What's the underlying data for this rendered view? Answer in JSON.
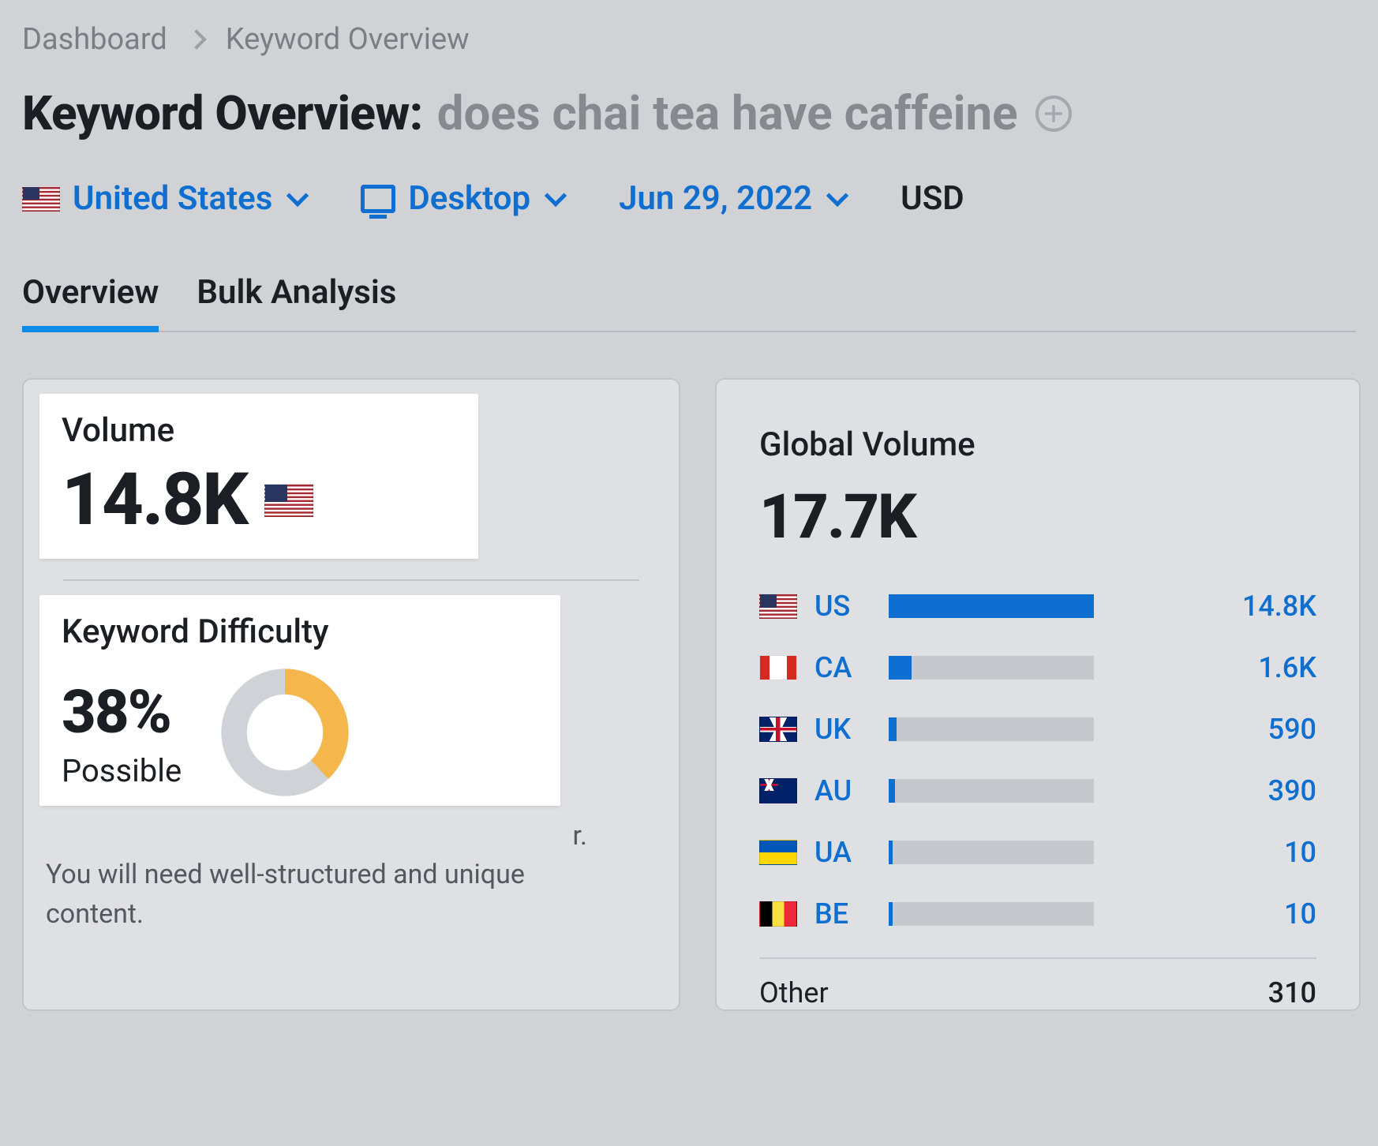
{
  "breadcrumb": {
    "dashboard": "Dashboard",
    "page": "Keyword Overview"
  },
  "title": {
    "label": "Keyword Overview:",
    "query": "does chai tea have caffeine"
  },
  "filters": {
    "country": "United States",
    "device": "Desktop",
    "date": "Jun 29, 2022",
    "currency": "USD"
  },
  "tabs": {
    "overview": "Overview",
    "bulk": "Bulk Analysis"
  },
  "volume": {
    "label": "Volume",
    "value": "14.8K"
  },
  "kd": {
    "label": "Keyword Difficulty",
    "percent": "38%",
    "rating": "Possible",
    "percent_num": 38,
    "desc_tail": "r.",
    "desc_line": "You will need well-structured and unique content."
  },
  "global": {
    "label": "Global Volume",
    "value": "17.7K",
    "max_abs": 14800,
    "countries": [
      {
        "code": "US",
        "flag": "us",
        "value": "14.8K",
        "abs": 14800
      },
      {
        "code": "CA",
        "flag": "ca",
        "value": "1.6K",
        "abs": 1600
      },
      {
        "code": "UK",
        "flag": "uk",
        "value": "590",
        "abs": 590
      },
      {
        "code": "AU",
        "flag": "au",
        "value": "390",
        "abs": 390
      },
      {
        "code": "UA",
        "flag": "ua",
        "value": "10",
        "abs": 10
      },
      {
        "code": "BE",
        "flag": "be",
        "value": "10",
        "abs": 10
      }
    ],
    "other": {
      "label": "Other",
      "value": "310"
    }
  }
}
